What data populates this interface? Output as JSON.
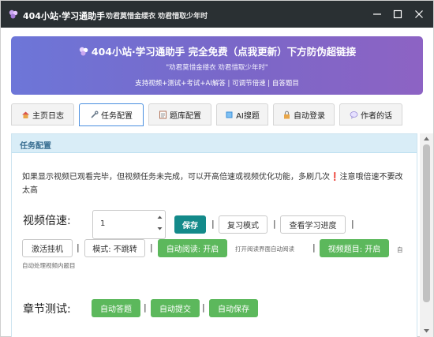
{
  "window": {
    "title": "404小站·学习通助手",
    "subtitle": "劝君莫惜金缕衣 劝君惜取少年时",
    "controls": [
      "minimize",
      "maximize",
      "close"
    ]
  },
  "banner": {
    "title": "404小站·学习通助手 完全免费（点我更新）下方防伪超链接",
    "subtitle": "\"劝君莫惜金缕衣 劝君惜取少年时\"",
    "features": "支持视频+测试+考试+AI解答 | 可调节倍速 | 自答题目",
    "icon": "puzzle-icon",
    "gradient_from": "#6d76d8",
    "gradient_to": "#8d63c4"
  },
  "tabs": [
    {
      "label": "主页日志",
      "icon": "home-icon"
    },
    {
      "label": "任务配置",
      "icon": "wrench-icon",
      "active": true
    },
    {
      "label": "题库配置",
      "icon": "notepad-icon"
    },
    {
      "label": "AI搜题",
      "icon": "book-icon"
    },
    {
      "label": "自动登录",
      "icon": "lock-icon"
    },
    {
      "label": "作者的话",
      "icon": "speech-bubble-icon"
    }
  ],
  "panel": {
    "heading": "任务配置",
    "notice_text": "如果显示视频已观看完毕，但视频任务未完成，可以开高倍速或视频优化功能，多刷几次",
    "notice_mark": "❗",
    "notice_tail": "注意哦倍速不要改太高",
    "video_speed": {
      "label": "视频倍速:",
      "value": "1",
      "save": "保存",
      "review_mode": "复习模式",
      "check_progress": "查看学习进度",
      "activate_hang": "激活挂机",
      "mode_no_jump": "模式: 不跳转",
      "auto_read": "自动阅读: 开启",
      "auto_read_hint": "打开阅读界面自动阅读",
      "video_questions": "视频题目: 开启",
      "video_questions_hint": "自动处理视频内题目"
    },
    "chapter_test": {
      "label": "章节测试:",
      "auto_answer": "自动答题",
      "auto_submit": "自动提交",
      "auto_save": "自动保存"
    }
  },
  "colors": {
    "titlebar": "#2a3033",
    "save_button": "#138a8a",
    "green_button": "#5cb85c",
    "panel_header": "#d9edf7",
    "active_tab_border": "#4a8fe0",
    "warning": "#d9303a"
  }
}
